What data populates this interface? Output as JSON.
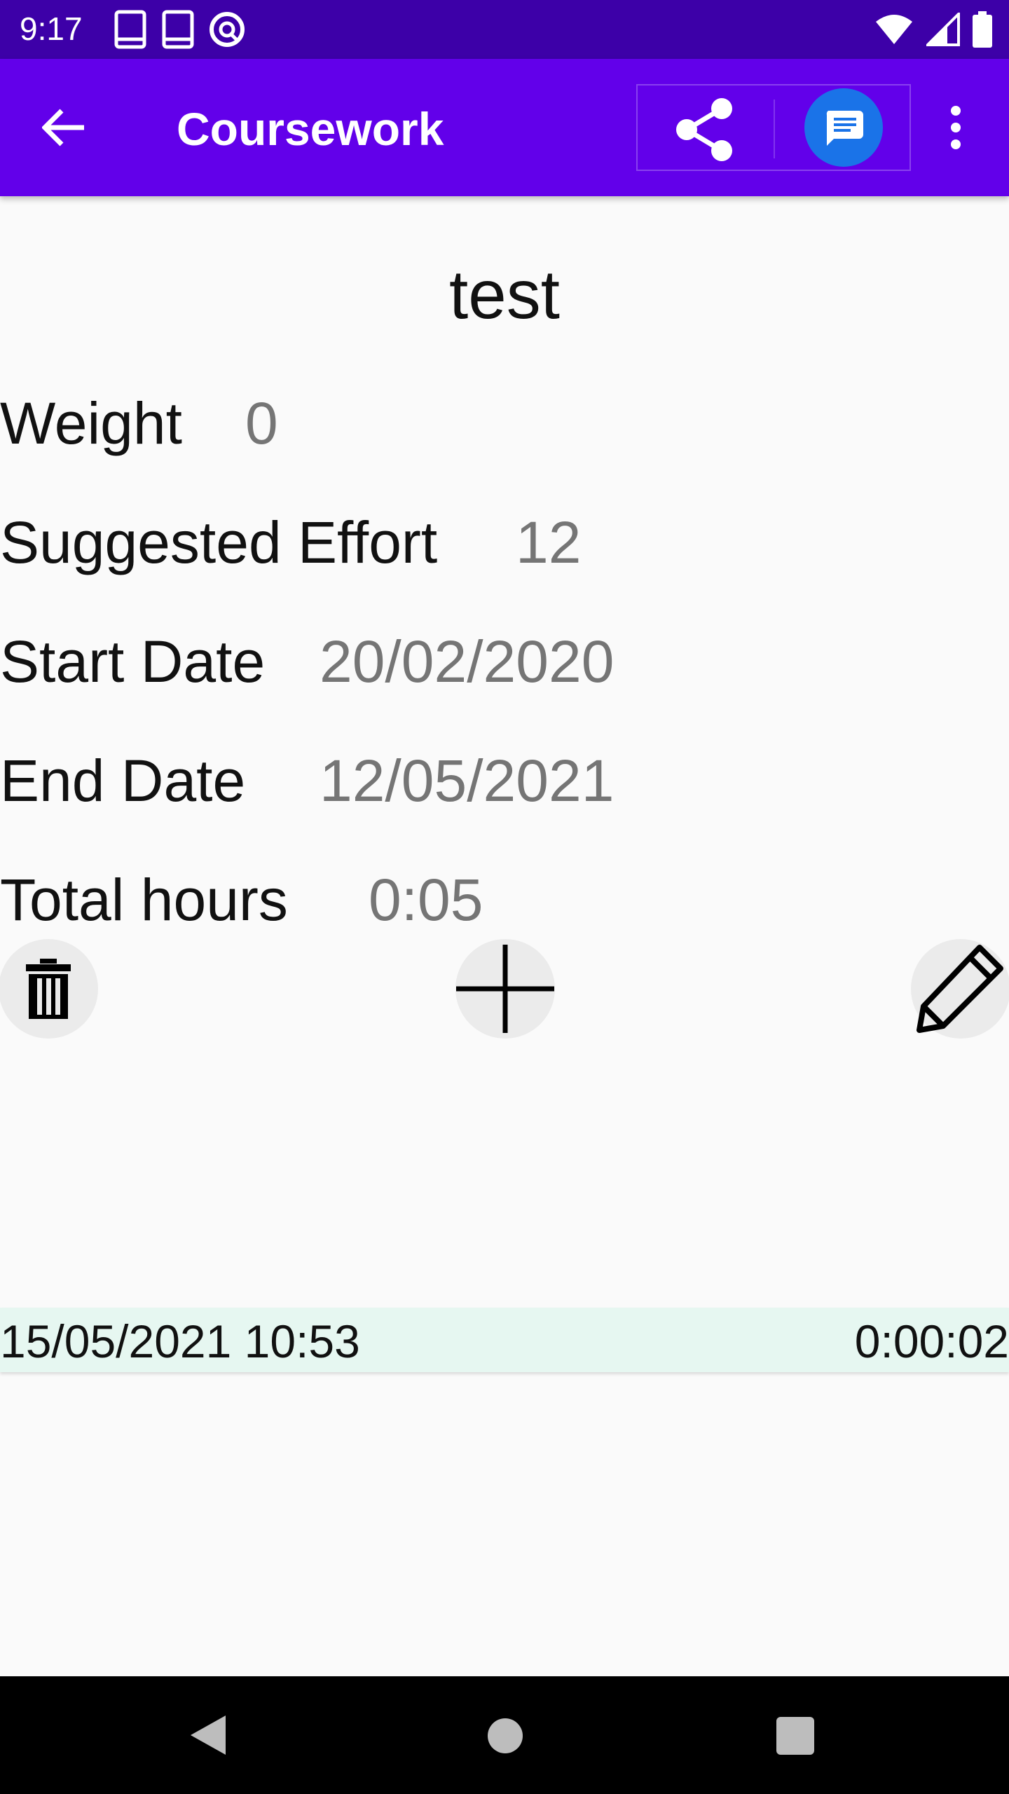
{
  "status_bar": {
    "time": "9:17",
    "left_icons": [
      "book-icon",
      "book-icon",
      "at-sign-icon"
    ],
    "right_icons": [
      "wifi-icon",
      "signal-icon",
      "battery-icon"
    ]
  },
  "app_bar": {
    "title": "Coursework",
    "back_icon": "arrow-back-icon",
    "actions": [
      "share-icon",
      "message-icon",
      "more-vert-icon"
    ],
    "color": "#6200ea"
  },
  "item": {
    "title": "test",
    "fields": {
      "weight": {
        "label": "Weight",
        "value": "0"
      },
      "suggested_effort": {
        "label": "Suggested Effort",
        "value": "12"
      },
      "start_date": {
        "label": "Start Date",
        "value": "20/02/2020"
      },
      "end_date": {
        "label": "End Date",
        "value": "12/05/2021"
      },
      "total_hours": {
        "label": "Total hours",
        "value": "0:05"
      }
    }
  },
  "actions": [
    "delete-icon",
    "add-icon",
    "edit-icon"
  ],
  "sessions": [
    {
      "datetime": "15/05/2021 10:53",
      "duration": "0:00:02"
    }
  ],
  "nav_bar": [
    "nav-back-icon",
    "nav-home-icon",
    "nav-recents-icon"
  ]
}
